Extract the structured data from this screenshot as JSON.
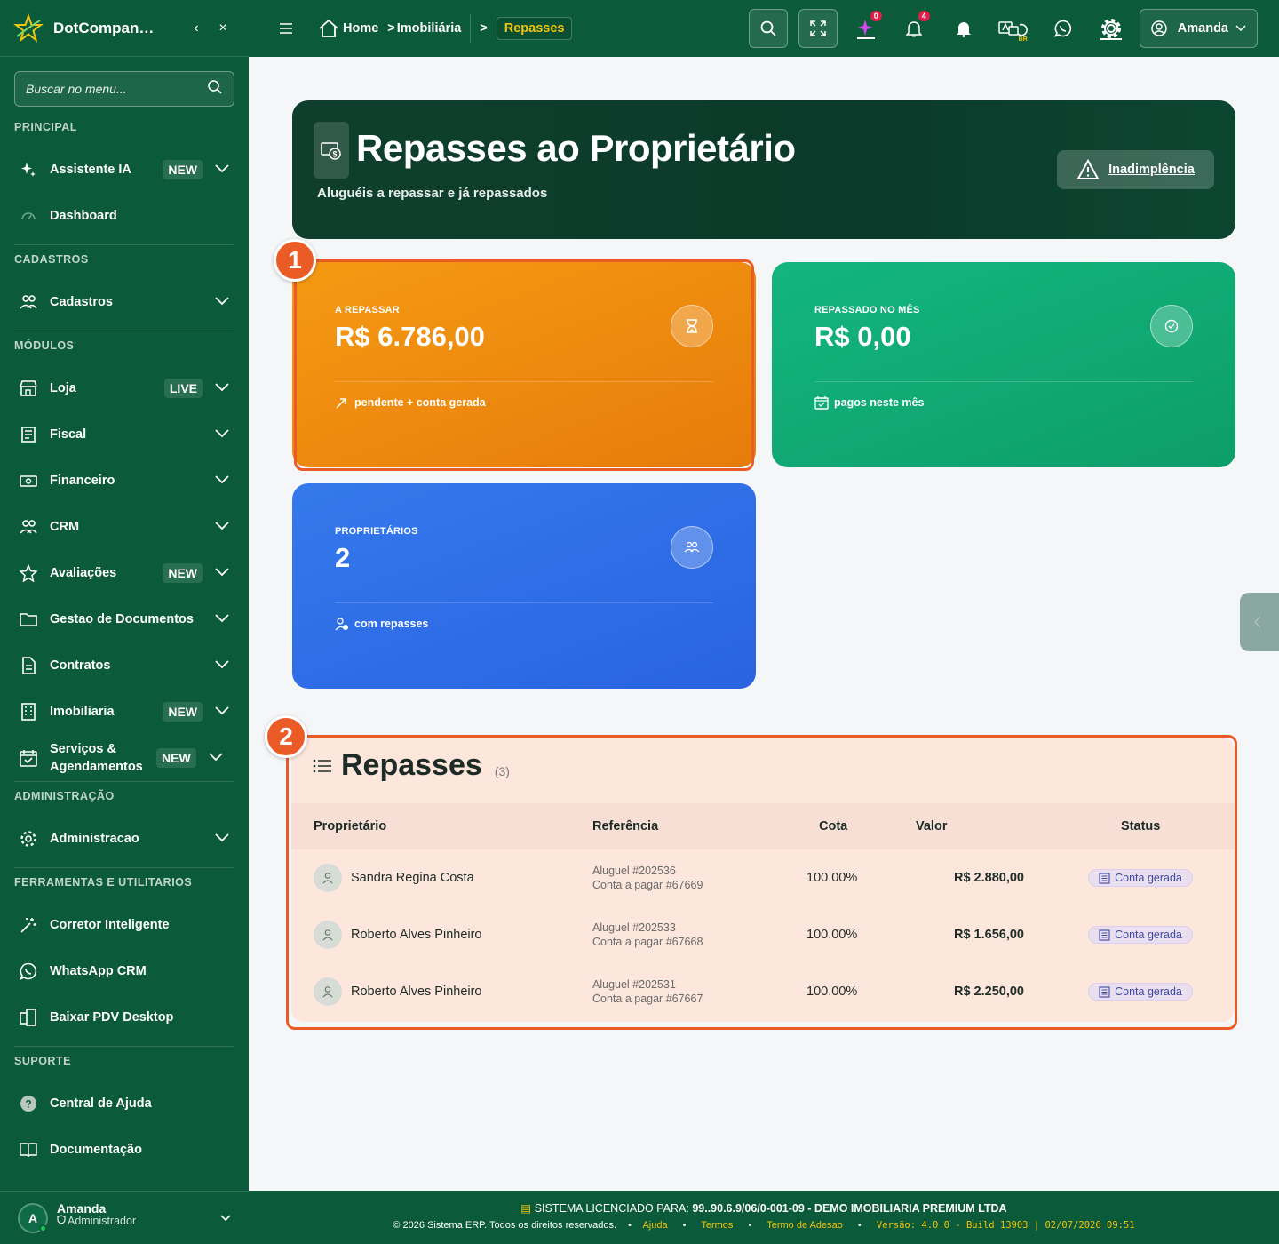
{
  "sidebar": {
    "brand": "DotCompan…",
    "search_placeholder": "Buscar no menu...",
    "sections": {
      "principal": "PRINCIPAL",
      "cadastros": "CADASTROS",
      "modulos": "MÓDULOS",
      "administracao": "ADMINISTRAÇÃO",
      "ferramentas": "FERRAMENTAS E UTILITARIOS",
      "suporte": "SUPORTE"
    },
    "items": {
      "assistente": {
        "label": "Assistente IA",
        "badge": "NEW"
      },
      "dashboard": {
        "label": "Dashboard"
      },
      "cadastros": {
        "label": "Cadastros"
      },
      "loja": {
        "label": "Loja",
        "badge": "LIVE"
      },
      "fiscal": {
        "label": "Fiscal"
      },
      "financeiro": {
        "label": "Financeiro"
      },
      "crm": {
        "label": "CRM"
      },
      "avaliacoes": {
        "label": "Avaliações",
        "badge": "NEW"
      },
      "documentos": {
        "label": "Gestao de Documentos"
      },
      "contratos": {
        "label": "Contratos"
      },
      "imobiliaria": {
        "label": "Imobiliaria",
        "badge": "NEW"
      },
      "servicos": {
        "label": "Serviços & Agendamentos",
        "badge": "NEW"
      },
      "administracao": {
        "label": "Administracao"
      },
      "corretor": {
        "label": "Corretor Inteligente"
      },
      "whatsapp": {
        "label": "WhatsApp CRM"
      },
      "pdv": {
        "label": "Baixar PDV Desktop"
      },
      "ajuda": {
        "label": "Central de Ajuda"
      },
      "docs": {
        "label": "Documentação"
      }
    },
    "user": {
      "initial": "A",
      "name": "Amanda",
      "role": "Administrador"
    }
  },
  "topbar": {
    "home": "Home",
    "crumb2": "Imobiliária",
    "crumb_active": "Repasses",
    "ai_badge": "0",
    "notif_badge": "4",
    "lang_tag": "BR",
    "user": "Amanda"
  },
  "hero": {
    "title": "Repasses ao Proprietário",
    "subtitle": "Aluguéis a repassar e já repassados",
    "button": "Inadimplência"
  },
  "cards": {
    "a_repassar": {
      "label": "A REPASSAR",
      "value": "R$ 6.786,00",
      "foot": "pendente + conta gerada",
      "color": "#f29010"
    },
    "repassado": {
      "label": "REPASSADO NO MÊS",
      "value": "R$ 0,00",
      "foot": "pagos neste mês",
      "color": "#12b37b"
    },
    "proprietarios": {
      "label": "PROPRIETÁRIOS",
      "value": "2",
      "foot": "com repasses",
      "color": "#2f74ea"
    }
  },
  "markers": {
    "one": "1",
    "two": "2"
  },
  "repasses": {
    "title": "Repasses",
    "count": "(3)",
    "headers": {
      "prop": "Proprietário",
      "ref": "Referência",
      "cota": "Cota",
      "valor": "Valor",
      "status": "Status"
    },
    "rows": [
      {
        "name": "Sandra Regina Costa",
        "ref1": "Aluguel #202536",
        "ref2": "Conta a pagar #67669",
        "cota": "100.00%",
        "valor": "R$ 2.880,00",
        "status": "Conta gerada"
      },
      {
        "name": "Roberto Alves Pinheiro",
        "ref1": "Aluguel #202533",
        "ref2": "Conta a pagar #67668",
        "cota": "100.00%",
        "valor": "R$ 1.656,00",
        "status": "Conta gerada"
      },
      {
        "name": "Roberto Alves Pinheiro",
        "ref1": "Aluguel #202531",
        "ref2": "Conta a pagar #67667",
        "cota": "100.00%",
        "valor": "R$ 2.250,00",
        "status": "Conta gerada"
      }
    ]
  },
  "footer": {
    "licensed_label": "SISTEMA LICENCIADO PARA:",
    "licensed_value": "99..90.6.9/06/0-001-09 - DEMO IMOBILIARIA PREMIUM LTDA",
    "copyright": "© 2026 Sistema ERP. Todos os direitos reservados.",
    "ajuda": "Ajuda",
    "termos": "Termos",
    "adesao": "Termo de Adesao",
    "version": "Versão: 4.0.0 - Build 13903 | 02/07/2026 09:51"
  }
}
